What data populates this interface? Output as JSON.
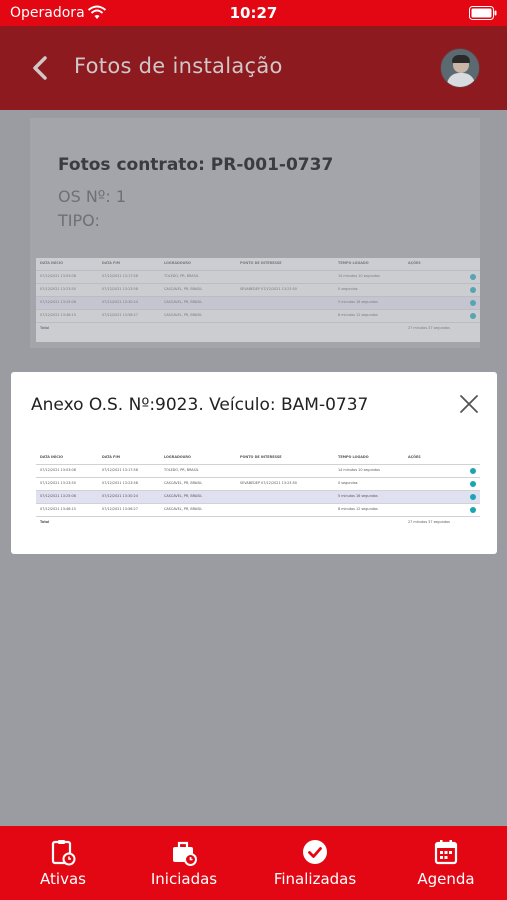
{
  "status_bar": {
    "carrier": "Operadora",
    "time": "10:27"
  },
  "header": {
    "title": "Fotos de instalação",
    "back_icon": "chevron-left-icon",
    "avatar": "user-avatar"
  },
  "contract": {
    "title": "Fotos contrato: PR-001-0737",
    "os_number": "OS Nº: 1",
    "tipo": "TIPO:"
  },
  "modal": {
    "title": "Anexo O.S. Nº:9023. Veículo: BAM-0737",
    "close_icon": "close-icon"
  },
  "attachment_table": {
    "columns": [
      "DATA INÍCIO",
      "DATA FIM",
      "LOGRADOURO",
      "PONTO DE INTERESSE",
      "TEMPO LOGADO",
      "AÇÕES"
    ],
    "rows": [
      [
        "07/12/2021 13:03:08",
        "07/12/2021 13:17:58",
        "TOLEDO, PR, BRASIL",
        "",
        "14 minutos 10 segundos",
        "•"
      ],
      [
        "07/12/2021 13:23:50",
        "07/12/2021 13:23:58",
        "CASCAVEL, PR, BRASIL",
        "SEVABEDEP 07/12/2021 13:23:50",
        "0 segundos",
        "•"
      ],
      [
        "07/12/2021 13:25:08",
        "07/12/2021 13:30:24",
        "CASCAVEL, PR, BRASIL",
        "",
        "5 minutos 16 segundos",
        "•"
      ],
      [
        "07/12/2021 13:48:15",
        "07/12/2021 13:56:27",
        "CASCAVEL, PR, BRASIL",
        "",
        "8 minutos 12 segundos",
        "•"
      ]
    ],
    "footer_label": "Total",
    "footer_value": "27 minutos 37 segundos"
  },
  "bottom_nav": [
    {
      "label": "Ativas",
      "icon": "clipboard-clock-icon"
    },
    {
      "label": "Iniciadas",
      "icon": "briefcase-clock-icon"
    },
    {
      "label": "Finalizadas",
      "icon": "check-circle-icon"
    },
    {
      "label": "Agenda",
      "icon": "calendar-icon"
    }
  ],
  "colors": {
    "primary": "#e30613",
    "header_dim": "#8c1a1f",
    "overlay_bg": "#9a9ca1",
    "action_dot": "#1aa5b5"
  }
}
